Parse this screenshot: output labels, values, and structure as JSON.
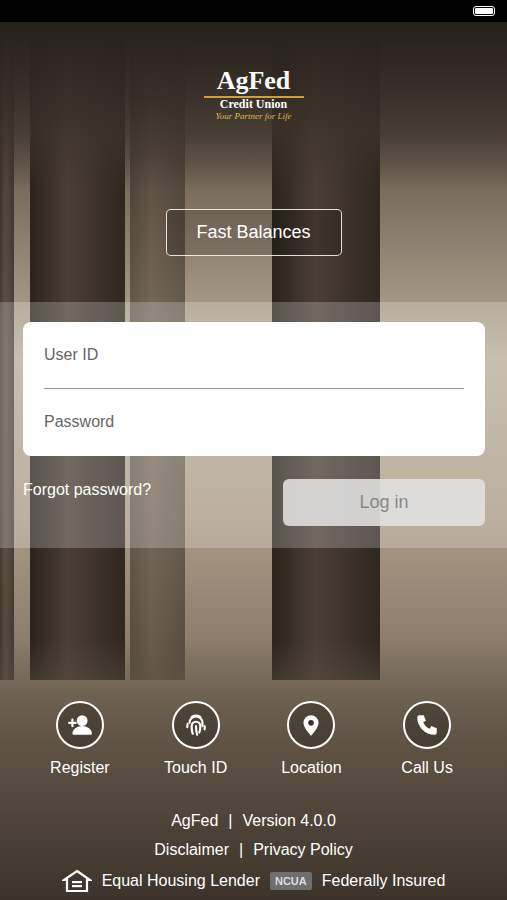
{
  "status_bar": {
    "battery_level": 1
  },
  "logo": {
    "name": "AgFed",
    "subtitle": "Credit Union",
    "tagline": "Your Partner for Life"
  },
  "fast_balances_button": {
    "label": "Fast Balances"
  },
  "login_form": {
    "fields": [
      {
        "placeholder": "User ID",
        "kind": "text"
      },
      {
        "placeholder": "Password",
        "kind": "password"
      }
    ],
    "forgot_link": "Forgot password?",
    "login_button": {
      "label": "Log in",
      "disabled": true
    }
  },
  "quick_actions": [
    {
      "label": "Register"
    },
    {
      "label": "Touch ID"
    },
    {
      "label": "Location"
    },
    {
      "label": "Call Us"
    }
  ],
  "footer": {
    "app_name": "AgFed",
    "separator": "|",
    "version": "Version 4.0.0",
    "links": [
      "Disclaimer",
      "Privacy Policy"
    ],
    "badges": [
      "Equal Housing Lender",
      "NCUA",
      "Federally Insured"
    ]
  }
}
